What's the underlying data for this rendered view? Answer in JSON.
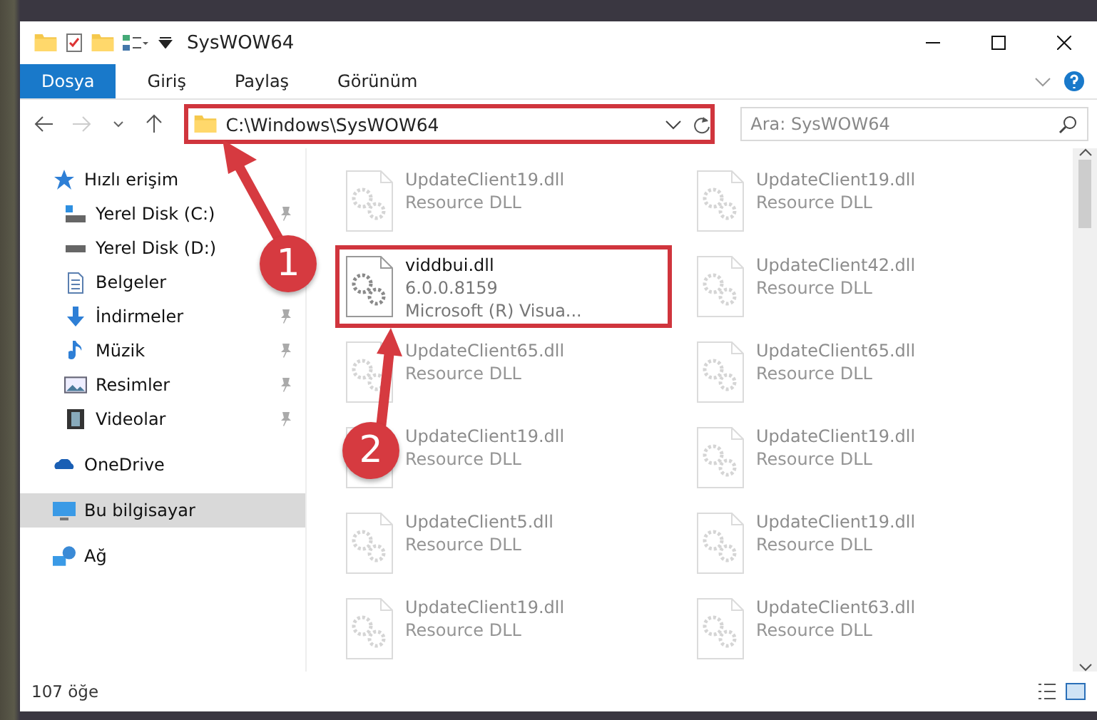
{
  "window": {
    "title": "SysWOW64"
  },
  "ribbon_tabs": [
    {
      "label": "Dosya",
      "selected": true
    },
    {
      "label": "Giriş",
      "selected": false
    },
    {
      "label": "Paylaş",
      "selected": false
    },
    {
      "label": "Görünüm",
      "selected": false
    }
  ],
  "address": {
    "path": "C:\\Windows\\SysWOW64",
    "highlighted": true
  },
  "search": {
    "placeholder": "Ara: SysWOW64"
  },
  "sidebar": {
    "items": [
      {
        "label": "Hızlı erişim",
        "selected": false,
        "children": [
          {
            "label": "Yerel Disk (C:)",
            "pinned": true
          },
          {
            "label": "Yerel Disk (D:)"
          },
          {
            "label": "Belgeler"
          },
          {
            "label": "İndirmeler",
            "pinned": true
          },
          {
            "label": "Müzik",
            "pinned": true
          },
          {
            "label": "Resimler",
            "pinned": true
          },
          {
            "label": "Videolar",
            "pinned": true
          }
        ]
      },
      {
        "label": "OneDrive",
        "selected": false
      },
      {
        "label": "Bu bilgisayar",
        "selected": true
      },
      {
        "label": "Ağ",
        "selected": false
      }
    ]
  },
  "files": [
    {
      "name": "UpdateClient19.dll",
      "type": "Resource DLL",
      "faded": true,
      "highlighted": false
    },
    {
      "name": "UpdateClient19.dll",
      "type": "Resource DLL",
      "faded": true,
      "highlighted": false
    },
    {
      "name": "viddbui.dll",
      "version": "6.0.0.8159",
      "company": "Microsoft (R) Visua...",
      "faded": false,
      "highlighted": true
    },
    {
      "name": "UpdateClient42.dll",
      "type": "Resource DLL",
      "faded": true,
      "highlighted": false
    },
    {
      "name": "UpdateClient65.dll",
      "type": "Resource DLL",
      "faded": true,
      "highlighted": false
    },
    {
      "name": "UpdateClient65.dll",
      "type": "Resource DLL",
      "faded": true,
      "highlighted": false
    },
    {
      "name": "UpdateClient19.dll",
      "type": "Resource DLL",
      "faded": true,
      "highlighted": false
    },
    {
      "name": "UpdateClient19.dll",
      "type": "Resource DLL",
      "faded": true,
      "highlighted": false
    },
    {
      "name": "UpdateClient5.dll",
      "type": "Resource DLL",
      "faded": true,
      "highlighted": false
    },
    {
      "name": "UpdateClient19.dll",
      "type": "Resource DLL",
      "faded": true,
      "highlighted": false
    },
    {
      "name": "UpdateClient19.dll",
      "type": "Resource DLL",
      "faded": true,
      "highlighted": false
    },
    {
      "name": "UpdateClient63.dll",
      "type": "Resource DLL",
      "faded": true,
      "highlighted": false
    }
  ],
  "status_bar": {
    "count": "107 öğe"
  },
  "annotations": [
    {
      "label": "1"
    },
    {
      "label": "2"
    }
  ]
}
